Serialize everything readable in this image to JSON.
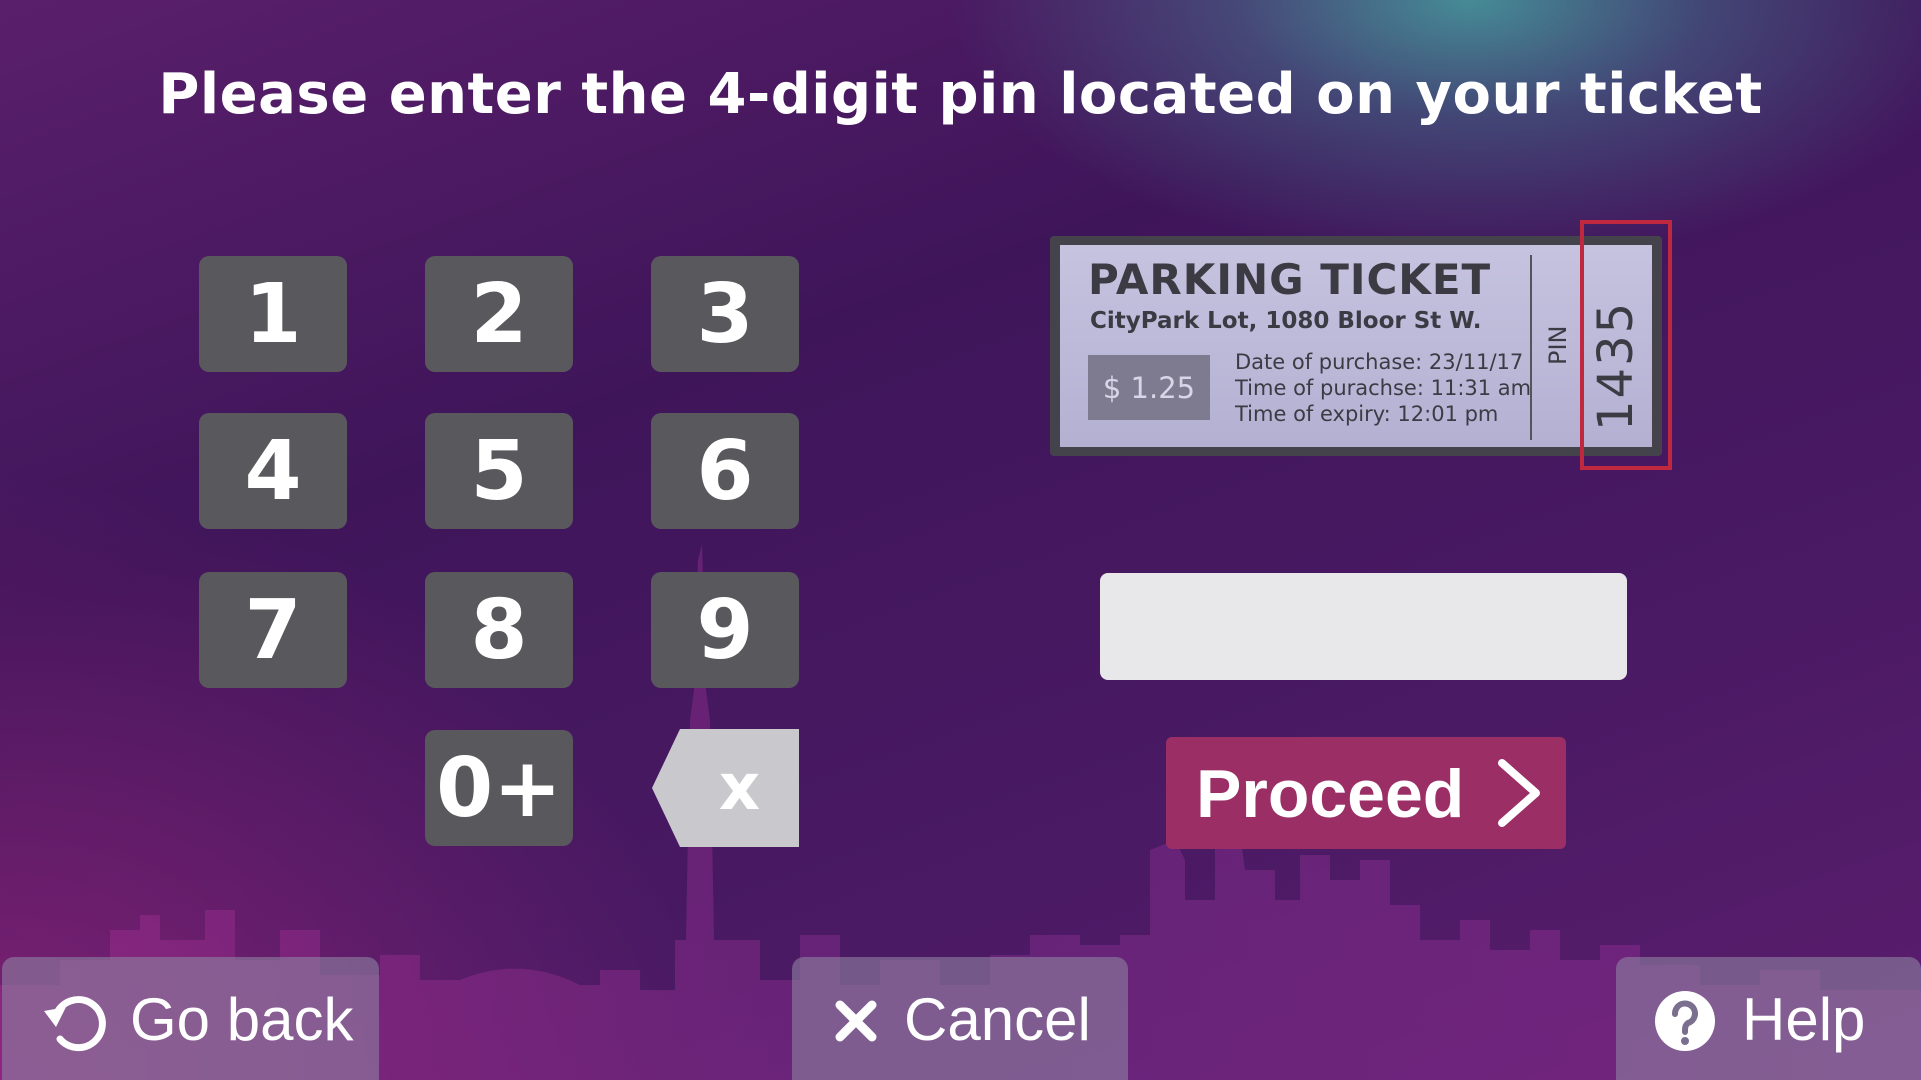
{
  "prompt": {
    "title": "Please enter the 4-digit pin located on your ticket"
  },
  "keypad": {
    "keys": [
      "1",
      "2",
      "3",
      "4",
      "5",
      "6",
      "7",
      "8",
      "9",
      "0+"
    ],
    "backspace_label": "x"
  },
  "ticket": {
    "heading": "PARKING TICKET",
    "address": "CityPark Lot, 1080 Bloor St W.",
    "price": "$ 1.25",
    "date_of_purchase": "Date of purchase: 23/11/17",
    "time_of_purchase": "Time of purachse: 11:31 am",
    "time_of_expiry": "Time of expiry: 12:01 pm",
    "pin_label": "PIN",
    "pin_value": "1435"
  },
  "pin_input": {
    "value": ""
  },
  "proceed_button": {
    "label": "Proceed"
  },
  "bottom_bar": {
    "go_back": "Go back",
    "cancel": "Cancel",
    "help": "Help"
  },
  "colors": {
    "keypad_key": "#58585d",
    "proceed": "#9a2e65",
    "pin_highlight": "#c0283f"
  }
}
